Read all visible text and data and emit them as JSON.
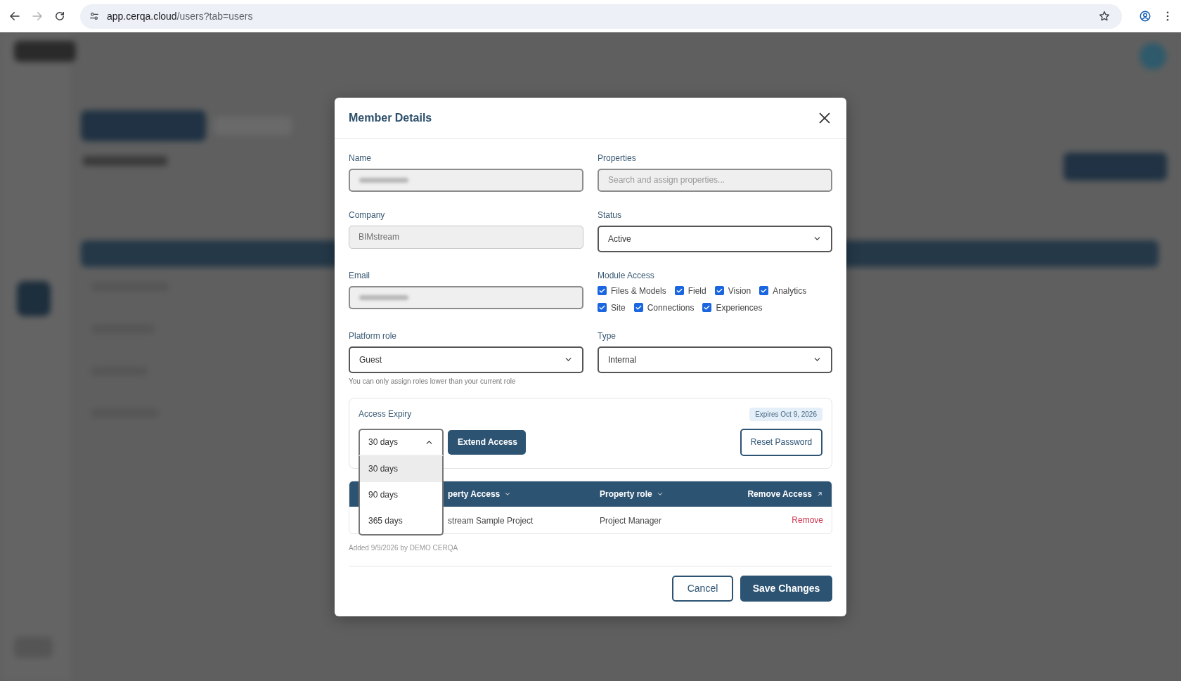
{
  "browser": {
    "url_host": "app.cerqa.cloud",
    "url_path": "/users?tab=users",
    "forward_disabled": true
  },
  "dialog": {
    "title": "Member Details",
    "left_column": [
      {
        "kind": "input",
        "label": "Name",
        "redacted": true,
        "disabled": false
      },
      {
        "kind": "input",
        "label": "Company",
        "value": "BIMstream",
        "disabled": true
      },
      {
        "kind": "input",
        "label": "Email",
        "redacted": true,
        "disabled": false
      },
      {
        "kind": "select",
        "label": "Platform role",
        "value": "Guest",
        "hint": "You can only assign roles lower than your current role"
      }
    ],
    "right_column": [
      {
        "kind": "input",
        "label": "Properties",
        "placeholder": "Search and assign properties...",
        "disabled": false
      },
      {
        "kind": "select",
        "label": "Status",
        "value": "Active"
      },
      {
        "kind": "checkboxes",
        "label": "Module Access",
        "options": [
          {
            "label": "Files & Models",
            "checked": true
          },
          {
            "label": "Field",
            "checked": true
          },
          {
            "label": "Vision",
            "checked": true
          },
          {
            "label": "Analytics",
            "checked": true
          },
          {
            "label": "Site",
            "checked": true
          },
          {
            "label": "Connections",
            "checked": true
          },
          {
            "label": "Experiences",
            "checked": true
          }
        ]
      },
      {
        "kind": "select",
        "label": "Type",
        "value": "Internal"
      }
    ],
    "access_expiry": {
      "label": "Access Expiry",
      "badge": "Expires Oct 9, 2026",
      "duration": {
        "value": "30 days",
        "expanded": true,
        "options": [
          {
            "label": "30 days",
            "selected": true
          },
          {
            "label": "90 days",
            "selected": false
          },
          {
            "label": "365 days",
            "selected": false
          }
        ]
      },
      "extend_button": "Extend Access",
      "reset_button": "Reset Password"
    },
    "table": {
      "columns": [
        {
          "label": "perty Access",
          "kind": "sortable"
        },
        {
          "label": "Property role",
          "kind": "sortable"
        },
        {
          "label": "Remove Access",
          "kind": "link"
        }
      ],
      "rows": [
        {
          "property": "stream Sample Project",
          "role": "Project Manager",
          "action": "Remove"
        }
      ]
    },
    "note": "Added 9/9/2026 by DEMO CERQA",
    "buttons": [
      {
        "label": "Cancel",
        "kind": "secondary"
      },
      {
        "label": "Save Changes",
        "kind": "primary"
      }
    ]
  }
}
